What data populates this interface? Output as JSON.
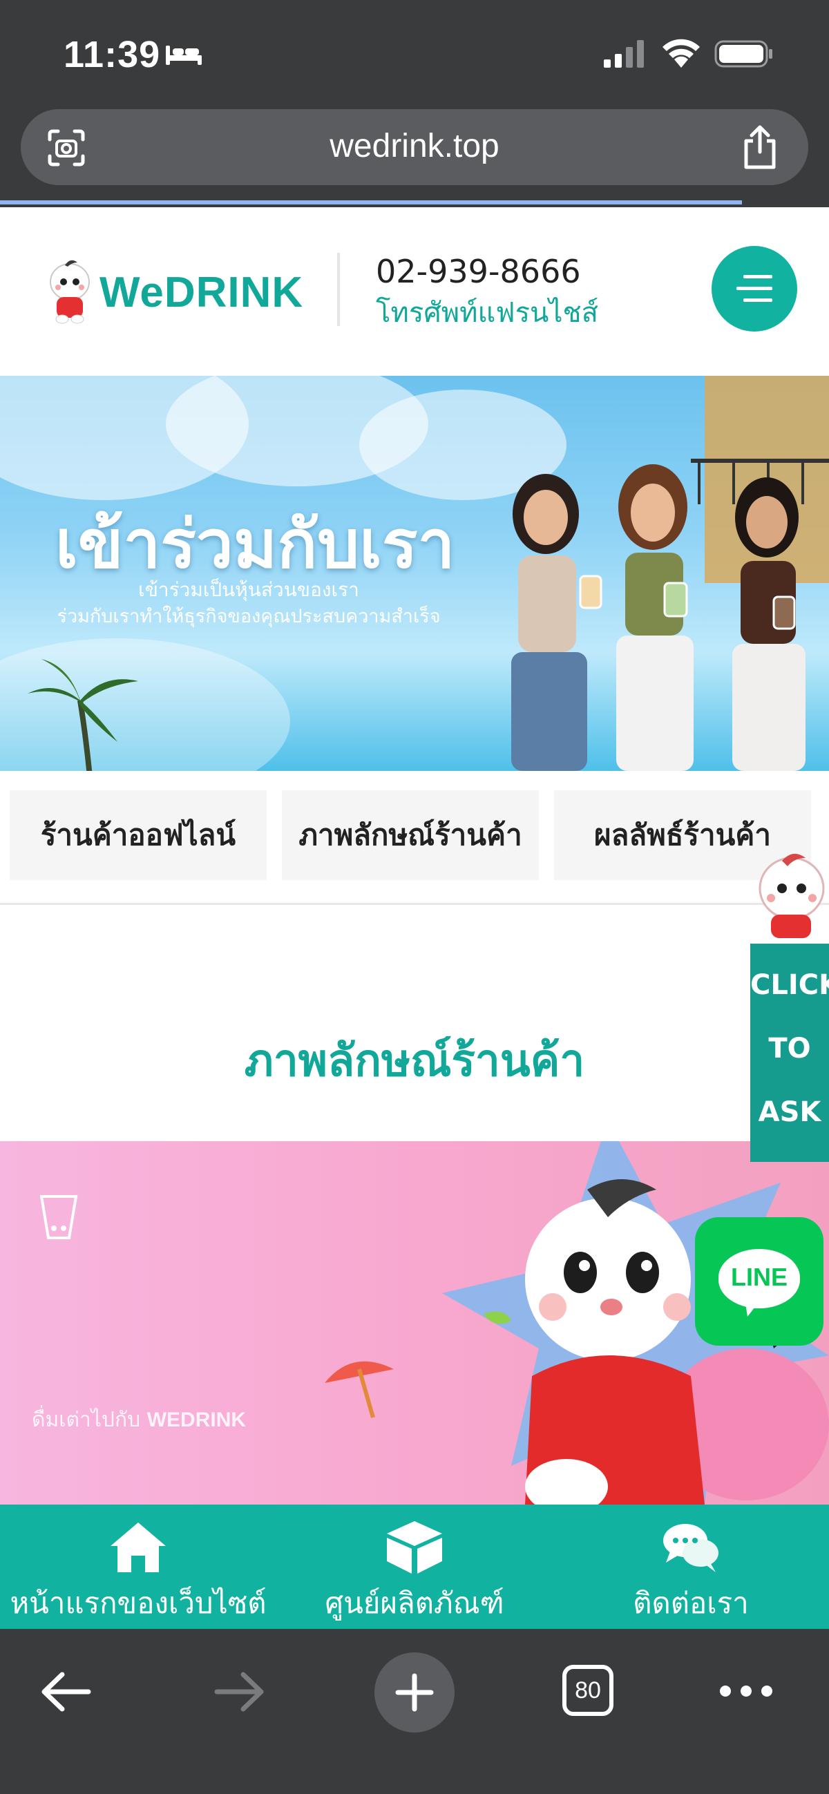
{
  "status_bar": {
    "time": "11:39",
    "icons": [
      "sleep-bed-icon",
      "cellular-signal-icon",
      "wifi-icon",
      "battery-icon"
    ]
  },
  "browser": {
    "url": "wedrink.top",
    "left_icon": "lens-scan-icon",
    "right_icon": "share-icon",
    "tab_count": "80",
    "load_progress": 0.895,
    "toolbar_icons": [
      "back-arrow-icon",
      "forward-arrow-icon",
      "new-tab-plus-icon",
      "tabs-icon",
      "more-icon"
    ]
  },
  "header": {
    "logo_text": "WeDRINK",
    "phone": "02-939-8666",
    "phone_caption": "โทรศัพท์แฟรนไชส์",
    "menu_icon": "hamburger-menu-icon"
  },
  "hero": {
    "title": "เข้าร่วมกับเรา",
    "subtitle_1": "เข้าร่วมเป็นหุ้นส่วนของเรา",
    "subtitle_2": "ร่วมกับเราทำให้ธุรกิจของคุณประสบความสำเร็จ"
  },
  "tabs": [
    {
      "label": "ร้านค้าออฟไลน์"
    },
    {
      "label": "ภาพลักษณ์ร้านค้า"
    },
    {
      "label": "ผลลัพธ์ร้านค้า"
    }
  ],
  "section": {
    "title": "ภาพลักษณ์ร้านค้า"
  },
  "promo": {
    "brand_line": "ดื่มเต่าไปกับ",
    "brand_name": "WEDRINK"
  },
  "float_widgets": {
    "ask_lines": [
      "CLICK",
      "TO",
      "ASK"
    ],
    "line_label": "LINE"
  },
  "bottom_nav": [
    {
      "label": "หน้าแรกของเว็บไซต์",
      "icon": "home-icon"
    },
    {
      "label": "ศูนย์ผลิตภัณฑ์",
      "icon": "box-icon"
    },
    {
      "label": "ติดต่อเรา",
      "icon": "chat-bubbles-icon"
    }
  ],
  "colors": {
    "brand_teal": "#11b3a0",
    "browser_chrome": "#3a3b3d",
    "line_green": "#06c655"
  }
}
